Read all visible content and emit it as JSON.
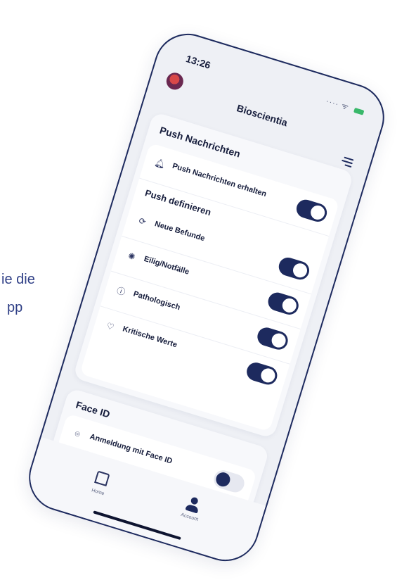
{
  "background_text": {
    "line1": "ie die",
    "line2": "pp"
  },
  "status_bar": {
    "time": "13:26",
    "indicators": "···· ᯤ"
  },
  "header": {
    "title": "Bioscientia"
  },
  "push": {
    "title": "Push Nachrichten",
    "receive_label": "Push Nachrichten erhalten",
    "receive_on": true,
    "define_title": "Push definieren",
    "items": [
      {
        "label": "Neue Befunde",
        "icon": "refresh-icon",
        "on": true
      },
      {
        "label": "Eilig/Notfälle",
        "icon": "siren-icon",
        "on": true
      },
      {
        "label": "Pathologisch",
        "icon": "alert-circle-icon",
        "on": true
      },
      {
        "label": "Kritische Werte",
        "icon": "heart-pulse-icon",
        "on": true
      }
    ]
  },
  "face_id": {
    "title": "Face ID",
    "label": "Anmeldung mit Face ID",
    "on": false
  },
  "tabs": {
    "home": "Home",
    "account": "Account"
  },
  "colors": {
    "accent": "#1d2a5e",
    "background": "#eef0f5"
  }
}
